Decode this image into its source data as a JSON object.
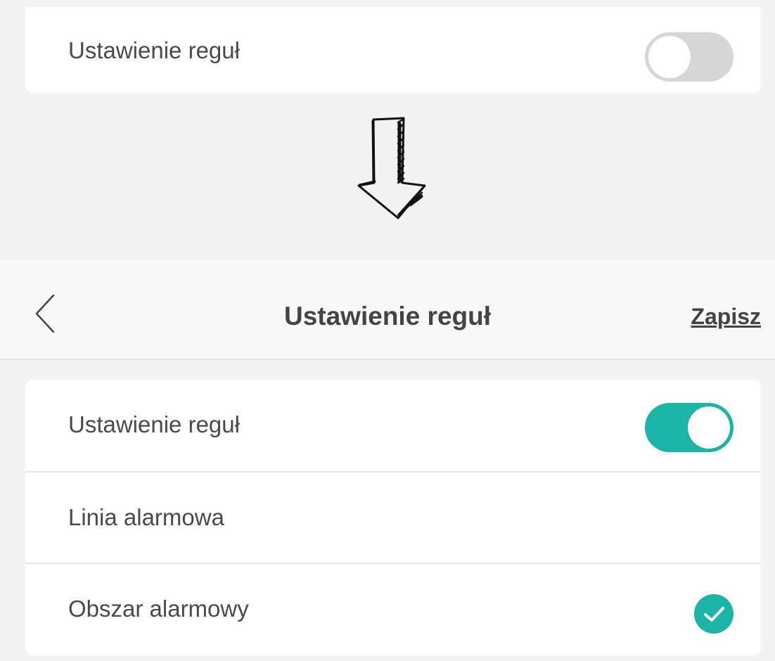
{
  "before": {
    "rule_setting_label": "Ustawienie reguł",
    "rule_setting_enabled": false
  },
  "header": {
    "title": "Ustawienie reguł",
    "save_label": "Zapisz"
  },
  "settings": {
    "rule_setting": {
      "label": "Ustawienie reguł",
      "enabled": true
    },
    "alarm_line": {
      "label": "Linia alarmowa",
      "selected": false
    },
    "alarm_area": {
      "label": "Obszar alarmowy",
      "selected": true
    }
  },
  "colors": {
    "accent": "#1ab4a8",
    "toggle_off": "#d6d6d6",
    "background": "#f3f3f3",
    "card": "#ffffff",
    "text": "#4a4a4a"
  }
}
